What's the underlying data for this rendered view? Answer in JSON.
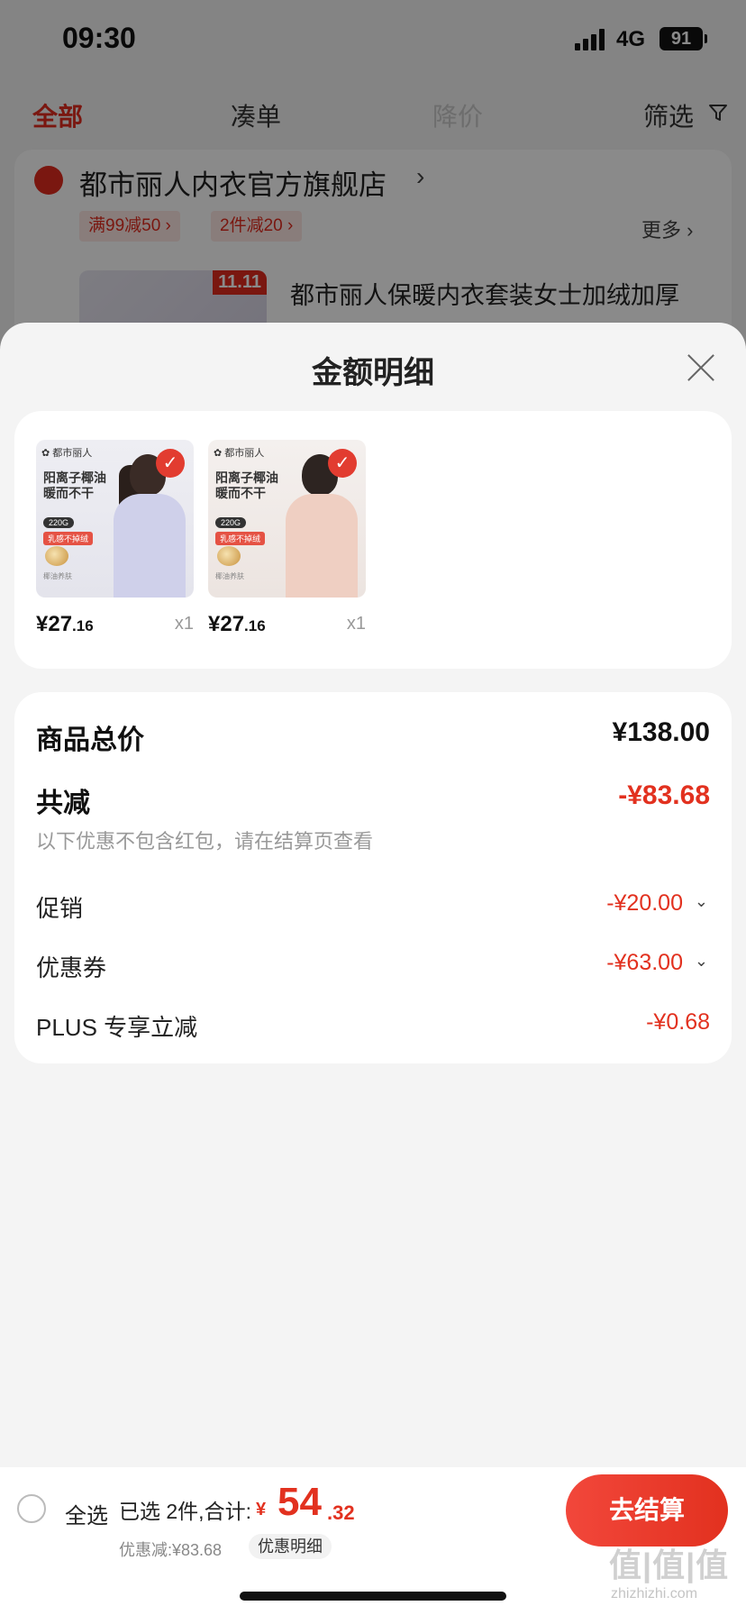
{
  "status_bar": {
    "time": "09:30",
    "network": "4G",
    "battery": "91"
  },
  "cart": {
    "tabs": [
      {
        "label": "全部"
      },
      {
        "label": "凑单"
      },
      {
        "label": "降价"
      },
      {
        "label": "筛选"
      }
    ],
    "store": {
      "name": "都市丽人内衣官方旗舰店",
      "promos": [
        "满99减50 ›",
        "2件减20 ›"
      ],
      "more_label": "更多 ›",
      "product_title": "都市丽人保暖内衣套装女士加绒加厚",
      "badge": "11.11"
    }
  },
  "sheet": {
    "title": "金额明细",
    "items": [
      {
        "brand": "都市丽人",
        "headline": "阳离子椰油 暖而不干",
        "weight": "220G",
        "tag": "乳感不掉绒",
        "note": "椰油养肤",
        "price_int": "¥27",
        "price_dec": ".16",
        "qty": "x1"
      },
      {
        "brand": "都市丽人",
        "headline": "阳离子椰油 暖而不干",
        "weight": "220G",
        "tag": "乳感不掉绒",
        "note": "椰油养肤",
        "price_int": "¥27",
        "price_dec": ".16",
        "qty": "x1"
      }
    ],
    "summary": {
      "subtotal_label": "商品总价",
      "subtotal_value": "¥138.00",
      "total_discount_label": "共减",
      "total_discount_value": "-¥83.68",
      "note": "以下优惠不包含红包，请在结算页查看",
      "promo_label": "促销",
      "promo_value": "-¥20.00",
      "coupon_label": "优惠券",
      "coupon_value": "-¥63.00",
      "plus_label": "PLUS 专享立减",
      "plus_value": "-¥0.68"
    }
  },
  "bottom_bar": {
    "select_all": "全选",
    "selected_info": "已选 2件,合计:",
    "total_symbol": "¥",
    "total_int": "54",
    "total_dec": ".32",
    "discount_line": "优惠减:¥83.68",
    "detail_chip": "优惠明细",
    "checkout": "去结算"
  },
  "watermark": {
    "main": "值|值|值",
    "sub": "zhizhizhi.com"
  },
  "colors": {
    "accent": "#e2311f",
    "sheet_bg": "#f4f4f4",
    "card_bg": "#ffffff"
  }
}
